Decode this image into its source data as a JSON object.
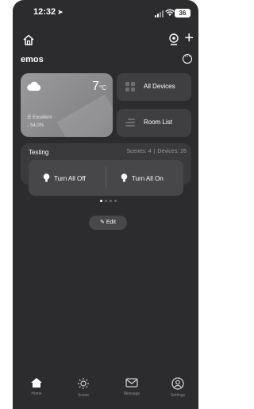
{
  "status_bar": {
    "time": "12:32",
    "battery": "36"
  },
  "header": {
    "home_name": "emos"
  },
  "weather": {
    "temperature": "7",
    "unit": "°C",
    "air_quality": "Excellent",
    "humidity": "54.0%"
  },
  "quick_tiles": [
    {
      "label": "All Devices",
      "icon": "devices-icon"
    },
    {
      "label": "Room List",
      "icon": "list-icon"
    }
  ],
  "room": {
    "name": "Testing",
    "scenes_text": "Scenes: 4",
    "separator": "|",
    "devices_text": "Devices: 26",
    "actions": [
      {
        "label": "Turn All Off",
        "icon": "bulb-icon"
      },
      {
        "label": "Turn All On",
        "icon": "bulb-icon"
      }
    ],
    "page_count": 4,
    "active_page": 0
  },
  "edit_button": {
    "label": "Edit"
  },
  "tabs": [
    {
      "label": "Home",
      "icon": "home-filled-icon",
      "active": true
    },
    {
      "label": "Scene",
      "icon": "sun-icon",
      "active": false
    },
    {
      "label": "Message",
      "icon": "envelope-icon",
      "active": false
    },
    {
      "label": "Settings",
      "icon": "profile-icon",
      "active": false
    }
  ],
  "colors": {
    "background": "#2c2c2e",
    "card": "#3f3f42",
    "weather_card": "#8f8f92",
    "muted_text": "#8e8e93"
  }
}
